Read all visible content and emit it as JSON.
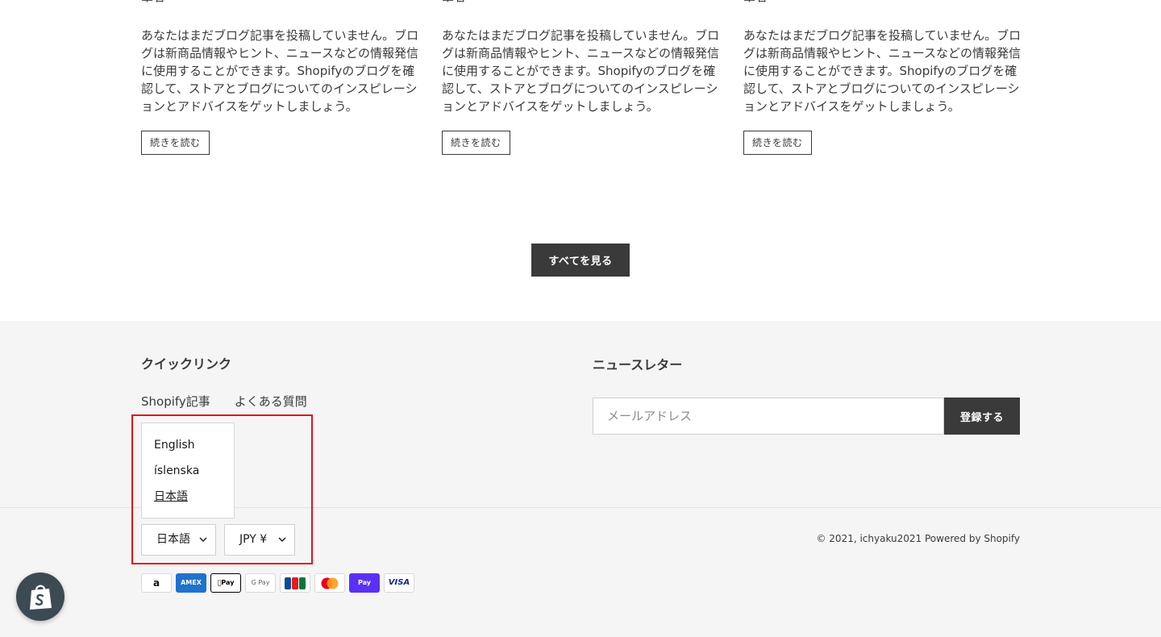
{
  "blog": {
    "posts": [
      {
        "author": "筆者",
        "excerpt": "あなたはまだブログ記事を投稿していません。ブログは新商品情報やヒント、ニュースなどの情報発信に使用することができます。Shopifyのブログを確認して、ストアとブログについてのインスピレーションとアドバイスをゲットしましょう。",
        "read_more": "続きを読む"
      },
      {
        "author": "筆者",
        "excerpt": "あなたはまだブログ記事を投稿していません。ブログは新商品情報やヒント、ニュースなどの情報発信に使用することができます。Shopifyのブログを確認して、ストアとブログについてのインスピレーションとアドバイスをゲットしましょう。",
        "read_more": "続きを読む"
      },
      {
        "author": "筆者",
        "excerpt": "あなたはまだブログ記事を投稿していません。ブログは新商品情報やヒント、ニュースなどの情報発信に使用することができます。Shopifyのブログを確認して、ストアとブログについてのインスピレーションとアドバイスをゲットしましょう。",
        "read_more": "続きを読む"
      }
    ],
    "view_all": "すべてを見る"
  },
  "footer": {
    "quick_links_heading": "クイックリンク",
    "quick_links": [
      "Shopify記事",
      "よくある質問"
    ],
    "newsletter_heading": "ニュースレター",
    "email_placeholder": "メールアドレス",
    "subscribe_label": "登録する",
    "language_options": [
      "English",
      "íslenska",
      "日本語"
    ],
    "language_selected": "日本語",
    "currency_selected": "JPY ¥",
    "copyright": "© 2021, ichyaku2021 Powered by Shopify",
    "payment_icons": [
      {
        "name": "amazon",
        "label": "a"
      },
      {
        "name": "amex",
        "label": "AMEX"
      },
      {
        "name": "apple-pay",
        "label": "Pay"
      },
      {
        "name": "google-pay",
        "label": "G Pay"
      },
      {
        "name": "jcb",
        "label": "JCB"
      },
      {
        "name": "mastercard",
        "label": ""
      },
      {
        "name": "shop-pay",
        "label": "Pay"
      },
      {
        "name": "visa",
        "label": "VISA"
      }
    ]
  },
  "colors": {
    "text": "#3a3a3a",
    "button_dark": "#3a3a3a",
    "footer_bg": "#f5f5f5",
    "highlight": "#e0151b",
    "shop_pay": "#5a31f4",
    "amex": "#1f72cd"
  }
}
